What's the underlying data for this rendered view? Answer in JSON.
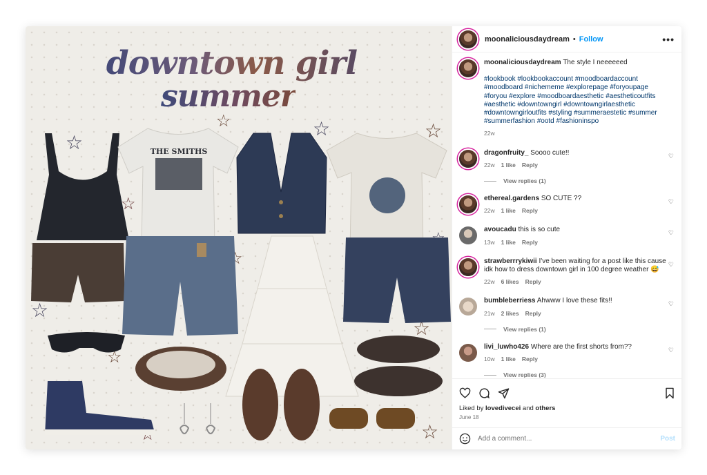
{
  "post_image": {
    "title_line1": "downtown girl",
    "title_line2": "summer",
    "tshirt_print": "THE SMITHS",
    "alt_items": [
      "black-camisole",
      "smiths-tee",
      "denim-vest",
      "white-tee",
      "brown-shorts",
      "denim-jorts",
      "white-tiered-skirt",
      "denim-shorts",
      "sport-sunglasses",
      "mary-jane-shoes",
      "navy-high-top-sneakers",
      "heart-earrings",
      "brown-clogs",
      "tortoise-sunglasses",
      "brown-mary-janes"
    ]
  },
  "header": {
    "username": "moonaliciousdaydream",
    "separator": "•",
    "follow_label": "Follow",
    "more_icon": "more-horizontal-icon"
  },
  "caption": {
    "username": "moonaliciousdaydream",
    "text": "The style I neeeeeed",
    "hashtags": "#lookbook #lookbookaccount #moodboardaccount #moodboard #nichememe #explorepage #foryoupage #foryou #explore #moodboardaesthetic #aestheticoutfits #aesthetic #downtowngirl #downtowngirlaesthetic #downtowngirloutfits #styling #summeraestetic #summer #summerfashion #ootd #fashioninspo",
    "time": "22w"
  },
  "comments": [
    {
      "username": "dragonfruity_",
      "text": "Soooo cute!!",
      "time": "22w",
      "likes": "1 like",
      "reply": "Reply",
      "view_replies": "View replies (1)",
      "ring": true
    },
    {
      "username": "ethereal.gardens",
      "text": "SO CUTE ??",
      "time": "22w",
      "likes": "1 like",
      "reply": "Reply",
      "view_replies": "",
      "ring": true
    },
    {
      "username": "avoucadu",
      "text": "this is so cute",
      "time": "13w",
      "likes": "1 like",
      "reply": "Reply",
      "view_replies": "",
      "ring": false
    },
    {
      "username": "strawberrrykiwii",
      "text": "I've been waiting for a post like this cause idk how to dress downtown girl in 100 degree weather 😅",
      "time": "22w",
      "likes": "6 likes",
      "reply": "Reply",
      "view_replies": "",
      "ring": true
    },
    {
      "username": "bumbleberriess",
      "text": "Ahwww I love these fits!!",
      "time": "21w",
      "likes": "2 likes",
      "reply": "Reply",
      "view_replies": "View replies (1)",
      "ring": false
    },
    {
      "username": "livi_luwho426",
      "text": "Where are the first shorts from??",
      "time": "10w",
      "likes": "1 like",
      "reply": "Reply",
      "view_replies": "View replies (3)",
      "ring": false
    }
  ],
  "actions": {
    "like_icon": "heart-icon",
    "comment_icon": "comment-icon",
    "share_icon": "send-icon",
    "save_icon": "bookmark-icon",
    "liked_by_prefix": "Liked by",
    "liked_by_user": "lovedivecei",
    "liked_by_and": "and",
    "liked_by_others": "others",
    "date": "June 18"
  },
  "add_comment": {
    "emoji_icon": "smiley-icon",
    "placeholder": "Add a comment...",
    "post_label": "Post"
  },
  "colors": {
    "follow_blue": "#0095f6",
    "hashtag_blue": "#00376b",
    "post_disabled": "#b2dffc",
    "story_ring": "#d6249f"
  }
}
